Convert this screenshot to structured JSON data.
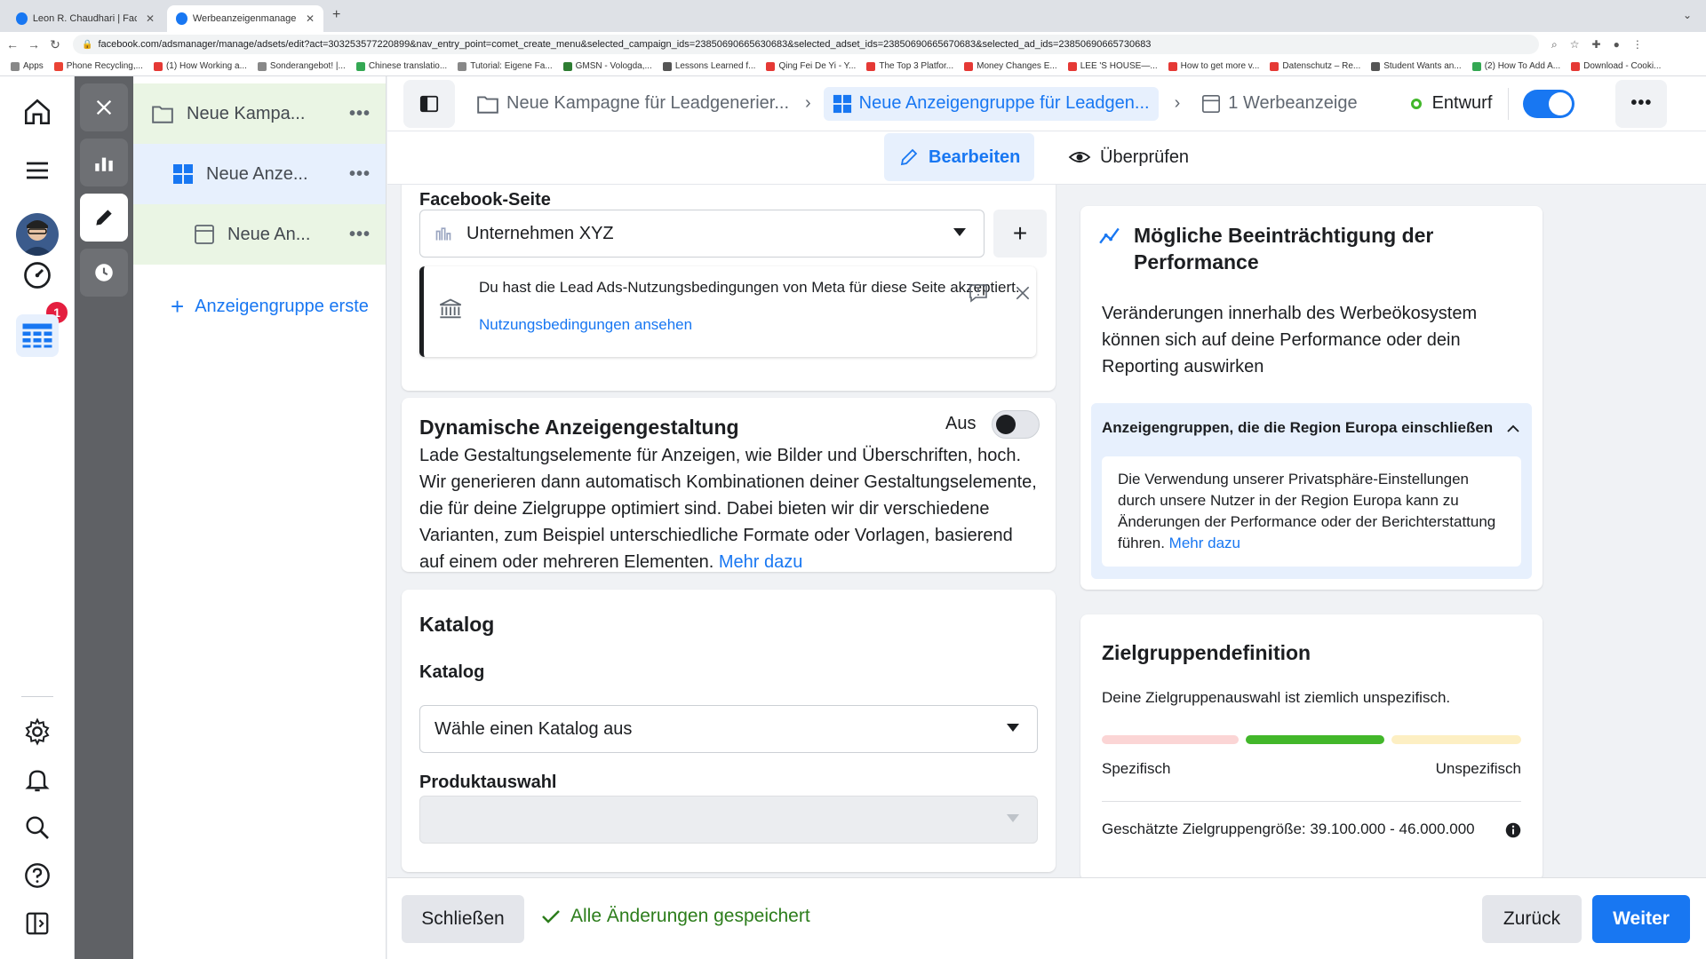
{
  "browser": {
    "tabs": [
      {
        "title": "Leon R. Chaudhari | Facebook"
      },
      {
        "title": "Werbeanzeigenmanager - We"
      }
    ],
    "url": "facebook.com/adsmanager/manage/adsets/edit?act=303253577220899&nav_entry_point=comet_create_menu&selected_campaign_ids=23850690665630683&selected_adset_ids=23850690665670683&selected_ad_ids=23850690665730683",
    "bookmarks": [
      "Apps",
      "Phone Recycling,...",
      "(1) How Working a...",
      "Sonderangebot! |...",
      "Chinese translatio...",
      "Tutorial: Eigene Fa...",
      "GMSN - Vologda,...",
      "Lessons Learned f...",
      "Qing Fei De Yi - Y...",
      "The Top 3 Platfor...",
      "Money Changes E...",
      "LEE 'S HOUSE—...",
      "How to get more v...",
      "Datenschutz – Re...",
      "Student Wants an...",
      "(2) How To Add A...",
      "Download - Cooki..."
    ]
  },
  "rail": {
    "notification_count": "1"
  },
  "tree": {
    "campaign": "Neue Kampa...",
    "adset": "Neue Anze...",
    "ad": "Neue An...",
    "create": "Anzeigengruppe erste"
  },
  "header": {
    "campaign_crumb": "Neue Kampagne für Leadgenerier...",
    "adset_crumb": "Neue Anzeigengruppe für Leadgen...",
    "ad_crumb": "1 Werbeanzeige",
    "status": "Entwurf",
    "edit": "Bearbeiten",
    "review": "Überprüfen"
  },
  "facebook_page": {
    "title": "Facebook-Seite",
    "selected": "Unternehmen XYZ",
    "notice_text": "Du hast die Lead Ads-Nutzungsbedingungen von Meta für diese Seite akzeptiert.",
    "notice_link": "Nutzungsbedingungen ansehen"
  },
  "dynamic": {
    "title": "Dynamische Anzeigengestaltung",
    "toggle_label": "Aus",
    "description": "Lade Gestaltungselemente für Anzeigen, wie Bilder und Überschriften, hoch. Wir generieren dann automatisch Kombinationen deiner Gestaltungselemente, die für deine Zielgruppe optimiert sind. Dabei bieten wir dir verschiedene Varianten, zum Beispiel unterschiedliche Formate oder Vorlagen, basierend auf einem oder mehreren Elementen.",
    "more": "Mehr dazu"
  },
  "catalog": {
    "title": "Katalog",
    "label": "Katalog",
    "placeholder": "Wähle einen Katalog aus",
    "product_label": "Produktauswahl"
  },
  "performance": {
    "title": "Mögliche Beeinträchtigung der Performance",
    "text": "Veränderungen innerhalb des Werbeökosystem können sich auf deine Performance oder dein Reporting auswirken",
    "accordion_title": "Anzeigengruppen, die die Region Europa einschließen",
    "accordion_text": "Die Verwendung unserer Privatsphäre-Einstellungen durch unsere Nutzer in der Region Europa kann zu Änderungen der Performance oder der Berichterstattung führen.",
    "more": "Mehr dazu"
  },
  "audience": {
    "title": "Zielgruppendefinition",
    "text": "Deine Zielgruppenauswahl ist ziemlich unspezifisch.",
    "left_label": "Spezifisch",
    "right_label": "Unspezifisch",
    "size_label": "Geschätzte Zielgruppengröße: 39.100.000 - 46.000.000"
  },
  "footer": {
    "close": "Schließen",
    "saved": "Alle Änderungen gespeichert",
    "back": "Zurück",
    "next": "Weiter"
  },
  "colors": {
    "accent": "#1877f2",
    "success": "#42b72a",
    "danger": "#e41e3f"
  }
}
